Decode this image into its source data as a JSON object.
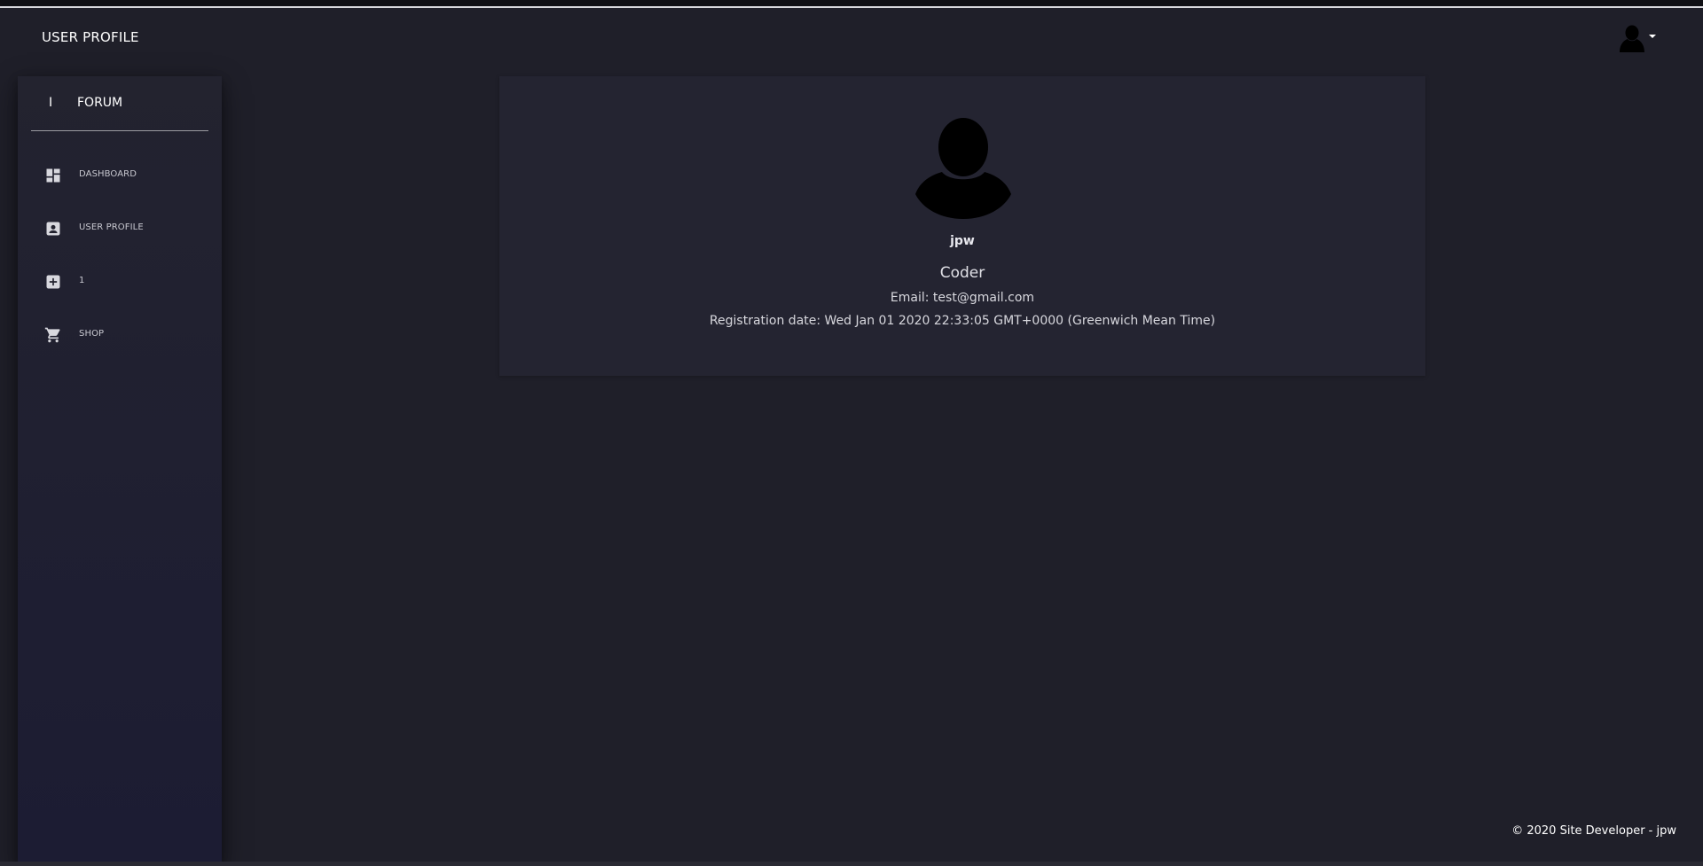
{
  "header": {
    "title": "USER PROFILE",
    "user_menu_icon": "account-avatar-icon"
  },
  "sidebar": {
    "brand_mini": "I",
    "brand_label": "FORUM",
    "items": [
      {
        "label": "DASHBOARD",
        "icon": "dashboard-icon"
      },
      {
        "label": "USER PROFILE",
        "icon": "contact-card-icon"
      },
      {
        "label": "1",
        "icon": "add-box-icon"
      },
      {
        "label": "SHOP",
        "icon": "shopping-cart-icon"
      }
    ]
  },
  "profile": {
    "avatar_icon": "person-silhouette-icon",
    "username": "jpw",
    "role": "Coder",
    "email_line": "Email: test@gmail.com",
    "registration_line": "Registration date: Wed Jan 01 2020 22:33:05 GMT+0000 (Greenwich Mean Time)"
  },
  "footer": {
    "prefix": "© 2020 Site Developer - ",
    "link": "jpw"
  },
  "colors": {
    "background": "#1f1f29",
    "sidebar_top": "#23232f",
    "sidebar_bottom": "#1c1c33",
    "card": "#242431",
    "text": "#ffffff"
  }
}
